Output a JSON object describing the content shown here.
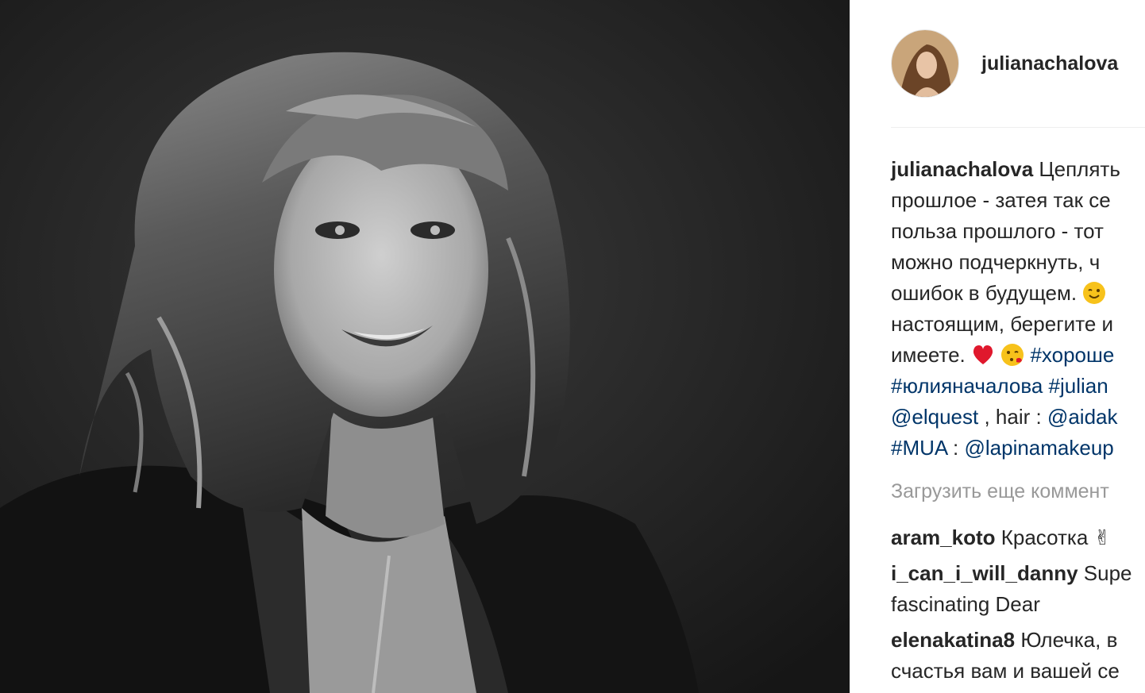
{
  "post": {
    "username": "julianachalova",
    "caption": {
      "author": "julianachalova",
      "line1_text": " Цеплять",
      "line2_text": "прошлое - затея так се",
      "line3_text": "польза прошлого - тот",
      "line4_text": "можно подчеркнуть, ч",
      "line5_text": "ошибок в будущем. ",
      "line6_text": "настоящим, берегите и",
      "line7_text": "имеете. ",
      "line7_tag": " #хороше",
      "line8_tag1": "#юлияначалова",
      "line8_tag2": " #julian",
      "line9_mention1": "@elquest",
      "line9_text": " , hair : ",
      "line9_mention2": "@aidak",
      "line10_tag": "#MUA",
      "line10_text": " : ",
      "line10_mention": "@lapinamakeup"
    },
    "load_more": "Загрузить еще коммент",
    "comments": [
      {
        "user": "aram_koto",
        "text": " Красотка ✌"
      },
      {
        "user": "i_can_i_will_danny",
        "text": " Supe",
        "text2": "fascinating Dear"
      },
      {
        "user": "elenakatina8",
        "text": " Юлечка, в",
        "text2": "счастья вам и вашей се"
      }
    ],
    "icons": {
      "wink": "wink-emoji-icon",
      "heart": "red-heart-emoji-icon",
      "kiss": "face-blowing-kiss-emoji-icon"
    },
    "colors": {
      "link": "#003569",
      "muted": "#999999",
      "text": "#262626"
    }
  }
}
